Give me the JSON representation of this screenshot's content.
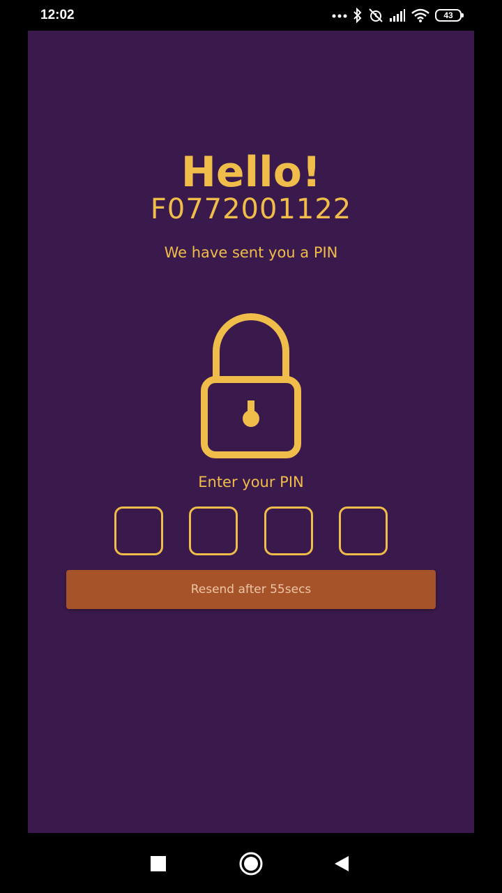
{
  "status_bar": {
    "time": "12:02",
    "battery_level": "43",
    "icons": [
      "more-dots-icon",
      "bluetooth-icon",
      "alarm-off-icon",
      "signal-icon",
      "wifi-icon",
      "battery-icon"
    ]
  },
  "colors": {
    "background": "#3a1a4c",
    "accent": "#f0bd4a",
    "button": "#a6532a",
    "button_text": "#eec6a6"
  },
  "screen": {
    "greeting": "Hello!",
    "user_id": "F0772001122",
    "subtitle": "We have sent you a PIN",
    "lock_icon": "lock-icon",
    "enter_pin_label": "Enter your PIN",
    "pin_digits": [
      "",
      "",
      "",
      ""
    ],
    "resend_label": "Resend after 55secs"
  },
  "nav_bar": {
    "items": [
      "recents-square-icon",
      "home-circle-icon",
      "back-triangle-icon"
    ]
  }
}
